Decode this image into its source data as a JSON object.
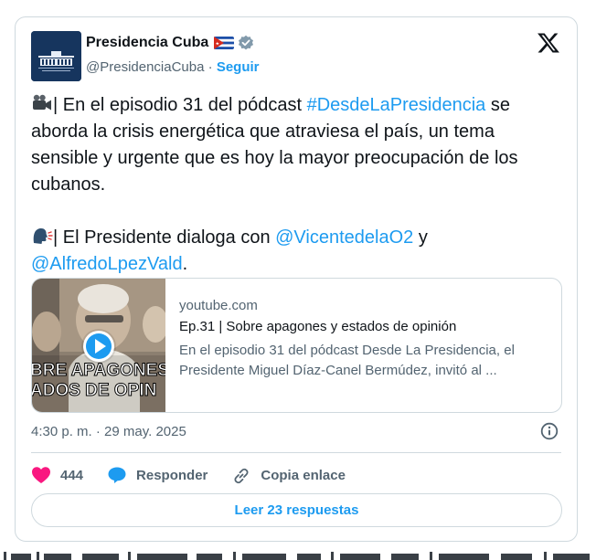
{
  "author": {
    "name": "Presidencia Cuba",
    "handle": "@PresidenciaCuba",
    "separator": "·",
    "follow_label": "Seguir"
  },
  "icons": {
    "avatar": "palacio-logo",
    "flag": "cuba-flag-icon",
    "verified": "verified-badge-icon",
    "x_logo": "x-logo-icon",
    "info": "info-icon",
    "like": "heart-icon",
    "reply": "speech-bubble-icon",
    "copy_link": "link-icon"
  },
  "tweet": {
    "p1": {
      "emoji": "🎥",
      "before": "| En el episodio 31 del pódcast ",
      "hashtag": "#DesdeLaPresidencia",
      "after": " se aborda la crisis energética que atraviesa el país, un tema sensible y urgente que es hoy la mayor preocupación de los cubanos."
    },
    "p2": {
      "emoji": "🗣️",
      "before": "| El Presidente dialoga con ",
      "mention1": "@VicentedelaO2",
      "middle": " y ",
      "mention2": "@AlfredoLpezVald",
      "after": "."
    }
  },
  "preview": {
    "domain": "youtube.com",
    "title": "Ep.31 | Sobre apagones y estados de opinión",
    "description": "En el episodio 31 del pódcast Desde La Presidencia, el Presidente Miguel Díaz-Canel Bermúdez, invitó al ...",
    "thumb_line1": "BRE APAGONES",
    "thumb_line2": "ADOS DE OPIN"
  },
  "meta": {
    "time": "4:30 p. m.",
    "separator": "·",
    "date": "29 may. 2025"
  },
  "actions": {
    "likes": "444",
    "reply_label": "Responder",
    "copy_label": "Copia enlace"
  },
  "read_replies": "Leer 23 respuestas",
  "colors": {
    "accent": "#1d9bf0",
    "heart": "#f91880",
    "text": "#0f1419",
    "secondary": "#536471",
    "border": "#cfd9de"
  }
}
